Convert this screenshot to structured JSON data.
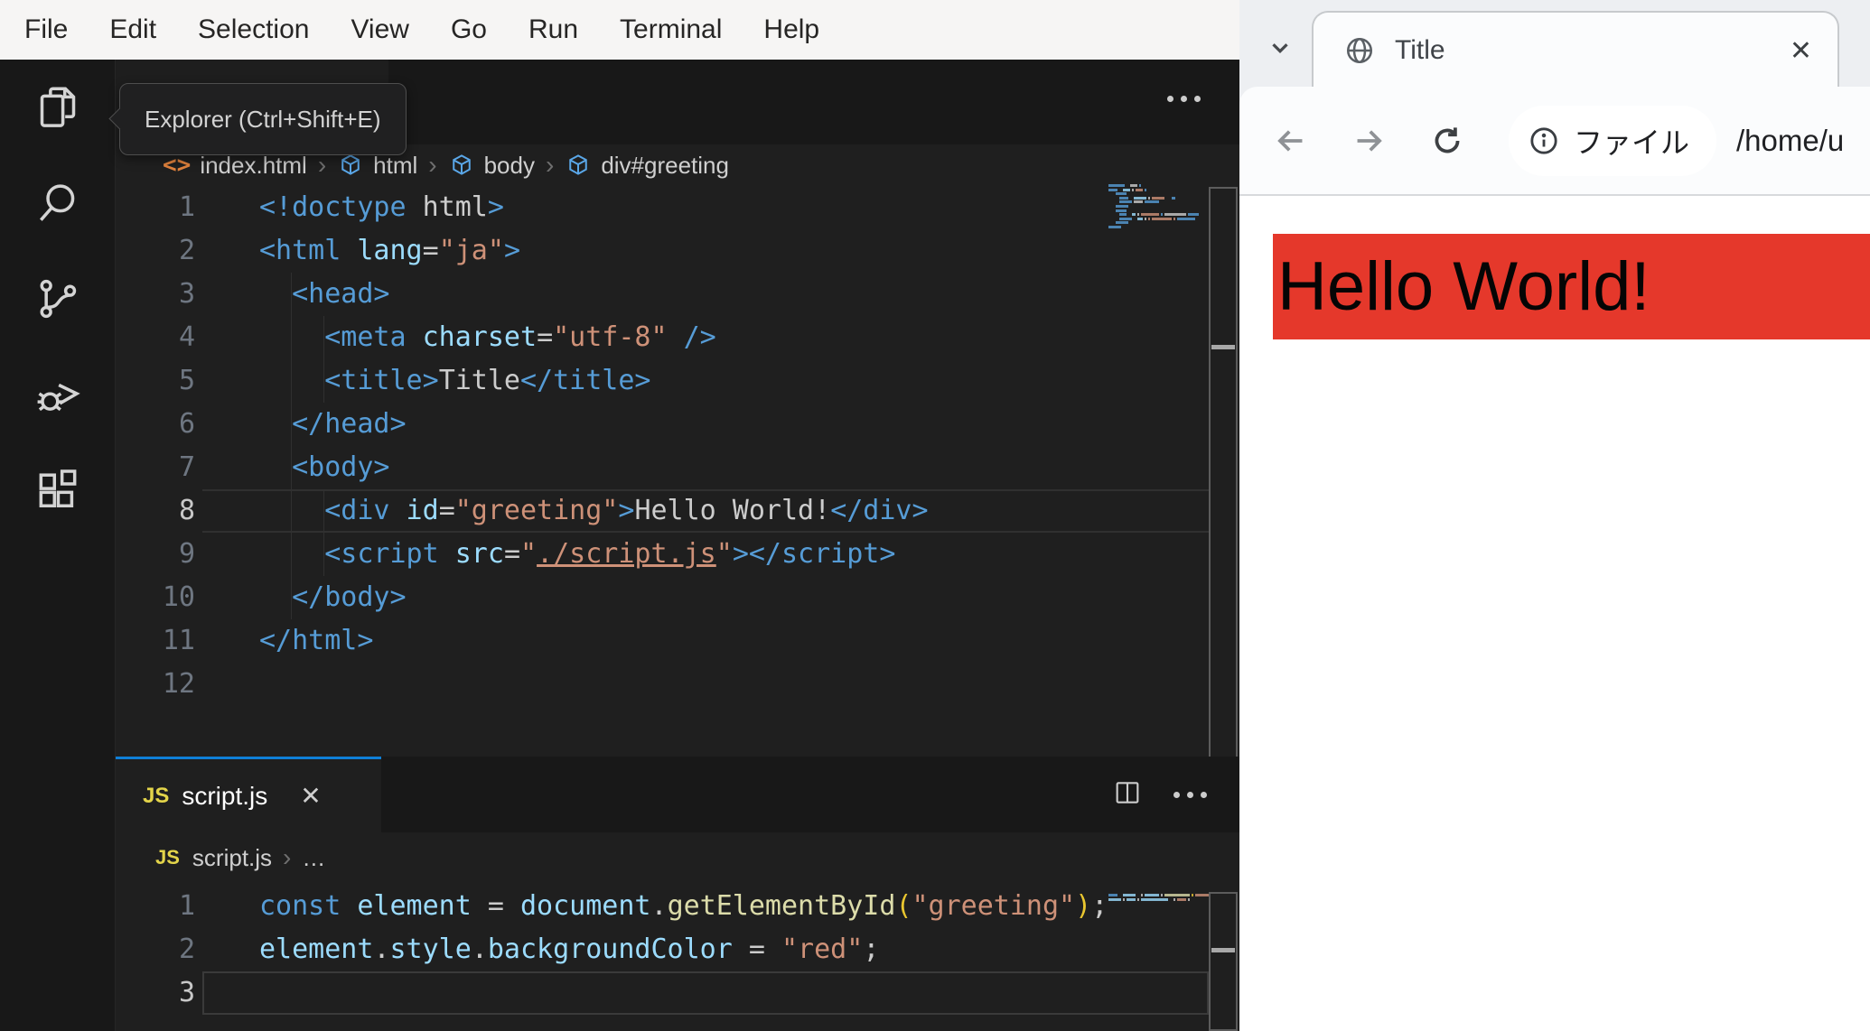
{
  "vscode": {
    "menu": {
      "items": [
        "File",
        "Edit",
        "Selection",
        "View",
        "Go",
        "Run",
        "Terminal",
        "Help"
      ]
    },
    "activity_tooltip": "Explorer (Ctrl+Shift+E)",
    "activity_items": [
      "explorer",
      "search",
      "source-control",
      "run-and-debug",
      "extensions"
    ],
    "accent_color": "#0f7fd7",
    "html_editor": {
      "breadcrumb": [
        "index.html",
        "html",
        "body",
        "div#greeting"
      ],
      "active_line": 8,
      "lines": [
        {
          "n": 1,
          "t": [
            [
              "tag",
              "<!doctype"
            ],
            [
              "txt",
              " html"
            ],
            [
              "tag",
              ">"
            ]
          ]
        },
        {
          "n": 2,
          "t": [
            [
              "tag",
              "<html"
            ],
            [
              "attr",
              " lang"
            ],
            [
              "txt",
              "="
            ],
            [
              "str",
              "\"ja\""
            ],
            [
              "tag",
              ">"
            ]
          ]
        },
        {
          "n": 3,
          "t": [
            [
              "txt",
              "  "
            ],
            [
              "tag",
              "<head>"
            ]
          ]
        },
        {
          "n": 4,
          "t": [
            [
              "txt",
              "    "
            ],
            [
              "tag",
              "<meta"
            ],
            [
              "attr",
              " charset"
            ],
            [
              "txt",
              "="
            ],
            [
              "str",
              "\"utf-8\""
            ],
            [
              "txt",
              " "
            ],
            [
              "tag",
              "/>"
            ]
          ]
        },
        {
          "n": 5,
          "t": [
            [
              "txt",
              "    "
            ],
            [
              "tag",
              "<title>"
            ],
            [
              "txt",
              "Title"
            ],
            [
              "tag",
              "</title>"
            ]
          ]
        },
        {
          "n": 6,
          "t": [
            [
              "txt",
              "  "
            ],
            [
              "tag",
              "</head>"
            ]
          ]
        },
        {
          "n": 7,
          "t": [
            [
              "txt",
              "  "
            ],
            [
              "tag",
              "<body>"
            ]
          ]
        },
        {
          "n": 8,
          "t": [
            [
              "txt",
              "    "
            ],
            [
              "tag",
              "<div"
            ],
            [
              "attr",
              " id"
            ],
            [
              "txt",
              "="
            ],
            [
              "str",
              "\"greeting\""
            ],
            [
              "tag",
              ">"
            ],
            [
              "txt",
              "Hello World!"
            ],
            [
              "tag",
              "</div>"
            ]
          ]
        },
        {
          "n": 9,
          "t": [
            [
              "txt",
              "    "
            ],
            [
              "tag",
              "<script"
            ],
            [
              "attr",
              " src"
            ],
            [
              "txt",
              "="
            ],
            [
              "str",
              "\""
            ],
            [
              "lnk",
              "./script.js"
            ],
            [
              "str",
              "\""
            ],
            [
              "tag",
              "></script>"
            ]
          ]
        },
        {
          "n": 10,
          "t": [
            [
              "txt",
              "  "
            ],
            [
              "tag",
              "</body>"
            ]
          ]
        },
        {
          "n": 11,
          "t": [
            [
              "tag",
              "</html>"
            ]
          ]
        },
        {
          "n": 12,
          "t": []
        }
      ]
    },
    "js_editor": {
      "tab_name": "script.js",
      "tab_icon": "JS",
      "breadcrumb": [
        "script.js",
        "…"
      ],
      "active_line": 3,
      "lines": [
        {
          "n": 1,
          "t": [
            [
              "kw",
              "const"
            ],
            [
              "attr",
              " element"
            ],
            [
              "txt",
              " = "
            ],
            [
              "attr",
              "document"
            ],
            [
              "txt",
              "."
            ],
            [
              "fn",
              "getElementById"
            ],
            [
              "par",
              "("
            ],
            [
              "str",
              "\"greeting\""
            ],
            [
              "par",
              ")"
            ],
            [
              "txt",
              ";"
            ]
          ]
        },
        {
          "n": 2,
          "t": [
            [
              "attr",
              "element"
            ],
            [
              "txt",
              "."
            ],
            [
              "attr",
              "style"
            ],
            [
              "txt",
              "."
            ],
            [
              "attr",
              "backgroundColor"
            ],
            [
              "txt",
              " = "
            ],
            [
              "str",
              "\"red\""
            ],
            [
              "txt",
              ";"
            ]
          ]
        },
        {
          "n": 3,
          "t": []
        }
      ]
    }
  },
  "browser": {
    "tab_title": "Title",
    "toolbar": {
      "chip_text": "ファイル",
      "url_text": "/home/u"
    },
    "page": {
      "banner_text": "Hello World!",
      "banner_color": "#e5382b",
      "text_color": "#050505"
    }
  }
}
